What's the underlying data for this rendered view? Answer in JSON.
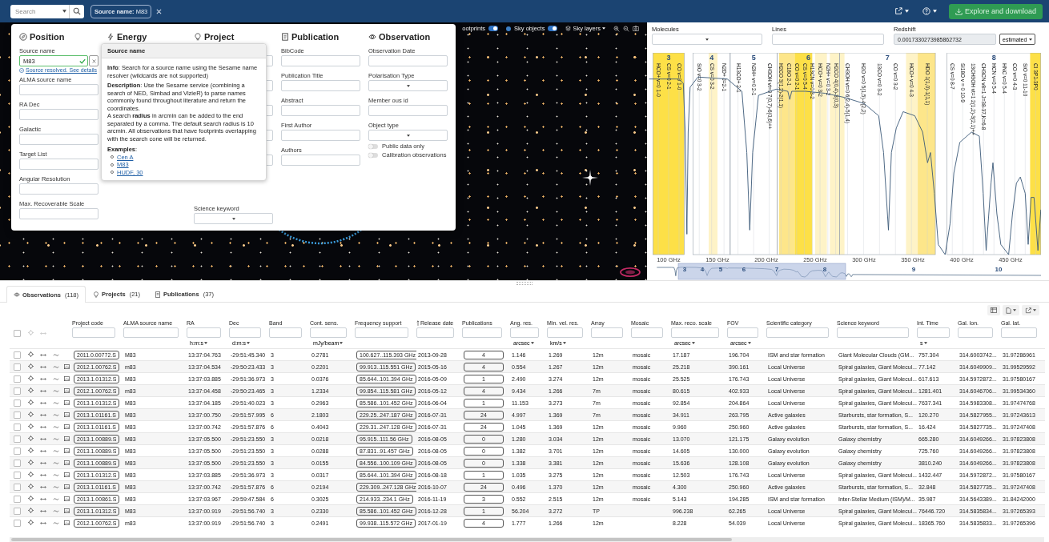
{
  "topbar": {
    "search_placeholder": "Search",
    "filter_chip": "**Source name:** M83",
    "explore_button": "Explore and download"
  },
  "sky": {
    "footprints_label": "ootprints",
    "footprints_on": true,
    "objects_label": "Sky objects",
    "objects_on": true,
    "layers_label": "Sky layers"
  },
  "search_panel": {
    "sections": [
      {
        "kind": "position",
        "title": "Position",
        "fields": [
          {
            "kind": "resolved",
            "label": "Source name",
            "value": "M83",
            "note": "Source resolved. See details"
          },
          {
            "kind": "text",
            "label": "ALMA source name"
          },
          {
            "kind": "text",
            "label": "RA Dec"
          },
          {
            "kind": "text",
            "label": "Galactic"
          },
          {
            "kind": "text",
            "label": "Target List"
          },
          {
            "kind": "text",
            "label": "Angular Resolution"
          },
          {
            "kind": "text",
            "label": "Max. Recoverable Scale"
          }
        ]
      },
      {
        "kind": "energy",
        "title": "Energy"
      },
      {
        "kind": "project",
        "title": "Project",
        "fields": [
          {
            "kind": "text"
          },
          {
            "kind": "text"
          },
          {
            "kind": "text"
          },
          {
            "kind": "text"
          },
          {
            "kind": "text"
          },
          {
            "kind": "select",
            "label": "Science keyword"
          }
        ]
      },
      {
        "kind": "publication",
        "title": "Publication",
        "fields": [
          {
            "kind": "text",
            "label": "BibCode"
          },
          {
            "kind": "text",
            "label": "Publication Title"
          },
          {
            "kind": "text",
            "label": "Abstract"
          },
          {
            "kind": "text",
            "label": "First Author"
          },
          {
            "kind": "text",
            "label": "Authors"
          }
        ]
      },
      {
        "kind": "observation",
        "title": "Observation",
        "fields": [
          {
            "kind": "text",
            "label": "Observation Date"
          },
          {
            "kind": "select",
            "label": "Polarisation Type"
          },
          {
            "kind": "text",
            "label": "Member ous id"
          },
          {
            "kind": "select",
            "label": "Object type"
          },
          {
            "kind": "toggle",
            "label": "Public data only",
            "on": false
          },
          {
            "kind": "toggle",
            "label": "Calibration observations",
            "on": false
          }
        ]
      }
    ],
    "tooltip": {
      "title": "Source name",
      "paragraphs": [
        "**Info**: Search for a source name using the Sesame name resolver (wildcards are not supported)",
        "**Description**: Use the Sesame service (combining a search of NED, Simbad and VizieR) to parse names commonly found throughout literature and return the coordinates.",
        "A search **radius** in arcmin can be added to the end separated by a comma. The default search radius is 10 arcmin. All observations that have footprints overlapping with the search cone will be returned."
      ],
      "examples_label": "**Examples**:",
      "examples": [
        "Cen A",
        "M83",
        "HUDF, 30"
      ]
    }
  },
  "spectrum": {
    "molecules_label": "Molecules",
    "lines_label": "Lines",
    "redshift_label": "Redshift",
    "redshift_value": "0.0017330273985862732",
    "redshift_mode": "estimated",
    "bands": [
      {
        "label": "3",
        "lines": [
          "HCO+ v=0 1-0",
          "CS v=0 2-1",
          "CO v=0 1-0"
        ]
      },
      {
        "label": "4",
        "lines": [
          "SiO v=0 3-2",
          "CS v=0 3-2",
          "N2D+ J=2-1"
        ]
      },
      {
        "label": "5",
        "lines": [
          "H13CO+ 2-1",
          "N2H+ v=0 2-1",
          "CH3OH vt=0 7(0,7)-6(0,6)++"
        ]
      },
      {
        "label": "6",
        "lines": [
          "H2CO 3(1,2)-2(1,1)",
          "C18O 2-1",
          "CO v=0 2-1",
          "CS v=0 5-4",
          "H13CN v=0 3-2",
          "HCO+ v=0 3-2",
          "N2H+ v=0 3-2",
          "H2CO 4(0,4)-3(0,3)"
        ]
      },
      {
        "label": "7",
        "lines": [
          "CH3OH vt=0 6(2,4)-5(1,4)",
          "H2O v=0 5(1,5)-4(2,2)",
          "13CO v=0 3-2",
          "CO v=0 3-2",
          "HCO+ v=0 4-3",
          "HDO 1(1,0)-1(1,1)"
        ]
      },
      {
        "label": "8",
        "lines": [
          "CS v=0 8-7",
          "Si18O v = 0 10-9",
          "13CH3OH vt=1 2(1,2)-3(2,1)++",
          "CH3CN v8=1 J=38-37,K=6-8",
          "HCN v=0 5-4",
          "HNC v=0 5-4",
          "CO v=0 4-3",
          "SiO v=0 11-10",
          "CI 3P1-3P0"
        ]
      }
    ],
    "xticks": [
      "100 GHz",
      "150 GHz",
      "200 GHz",
      "250 GHz",
      "300 GHz",
      "350 GHz",
      "400 GHz",
      "450 GHz"
    ],
    "overview_bands": [
      "3",
      "4",
      "5",
      "6",
      "7",
      "8",
      "9",
      "10"
    ]
  },
  "results": {
    "select_all": false,
    "tabs": [
      {
        "kind": "observations",
        "label": "Observations",
        "count": "(118)",
        "selected": true
      },
      {
        "kind": "projects",
        "label": "Projects",
        "count": "(21)",
        "selected": false
      },
      {
        "kind": "publications",
        "label": "Publications",
        "count": "(37)",
        "selected": false
      }
    ],
    "columns": [
      {
        "label": "Project code",
        "kind": "chip",
        "sorted": false
      },
      {
        "label": "ALMA source name",
        "kind": "text",
        "sorted": false
      },
      {
        "label": "RA",
        "kind": "text",
        "unit": "h:m:s",
        "sorted": false
      },
      {
        "label": "Dec",
        "kind": "text",
        "unit": "d:m:s",
        "sorted": false
      },
      {
        "label": "Band",
        "kind": "text",
        "sorted": false
      },
      {
        "label": "Cont. sens.",
        "kind": "text",
        "unit": "mJy/beam",
        "sorted": false
      },
      {
        "label": "Frequency support",
        "kind": "chip",
        "sorted": false
      },
      {
        "label": "Release date",
        "kind": "text",
        "sorted": true
      },
      {
        "label": "Publications",
        "kind": "chip",
        "sorted": false
      },
      {
        "label": "Ang. res.",
        "kind": "text",
        "unit": "arcsec",
        "sorted": false
      },
      {
        "label": "Min. vel. res.",
        "kind": "text",
        "unit": "km/s",
        "sorted": false
      },
      {
        "label": "Array",
        "kind": "text",
        "sorted": false
      },
      {
        "label": "Mosaic",
        "kind": "text",
        "sorted": false
      },
      {
        "label": "Max. reco. scale",
        "kind": "text",
        "unit": "arcsec",
        "sorted": false
      },
      {
        "label": "FOV",
        "kind": "text",
        "unit": "arcsec",
        "sorted": false
      },
      {
        "label": "Scientific category",
        "kind": "text",
        "sorted": false
      },
      {
        "label": "Science keyword",
        "kind": "text",
        "sorted": false
      },
      {
        "label": "Int. Time",
        "kind": "text",
        "unit": "s",
        "sorted": false
      },
      {
        "label": "Gal. lon.",
        "kind": "text",
        "sorted": false
      },
      {
        "label": "Gal. lat.",
        "kind": "text",
        "sorted": false
      }
    ],
    "rows": [
      {
        "selected": false,
        "preview": false,
        "cells": [
          "2011.0.00772.S",
          "M83",
          "13:37:04.763",
          "-29:51:45.340",
          "3",
          "0.2781",
          "100.627..115.393 GHz",
          "2013-09-28",
          "4",
          "1.146",
          "1.269",
          "12m",
          "mosaic",
          "17.187",
          "196.704",
          "ISM and star formation",
          "Giant Molecular Clouds (GM...",
          "757.304",
          "314.6003742...",
          "31.97286961"
        ]
      },
      {
        "selected": false,
        "preview": true,
        "cells": [
          "2012.1.00762.S",
          "m83",
          "13:37:04.534",
          "-29:50:23.433",
          "3",
          "0.2201",
          "99.913..115.551 GHz",
          "2015-05-16",
          "4",
          "0.554",
          "1.267",
          "12m",
          "mosaic",
          "25.218",
          "390.161",
          "Local Universe",
          "Spiral galaxies, Giant Molecul...",
          "77.142",
          "314.6049909...",
          "31.99529592"
        ]
      },
      {
        "selected": false,
        "preview": true,
        "cells": [
          "2013.1.01312.S",
          "M83",
          "13:37:03.885",
          "-29:51:36.973",
          "3",
          "0.0376",
          "85.644..101.394 GHz",
          "2016-05-09",
          "1",
          "2.490",
          "3.274",
          "12m",
          "mosaic",
          "25.525",
          "176.743",
          "Local Universe",
          "Spiral galaxies, Giant Molecul...",
          "617.613",
          "314.5972872...",
          "31.97580167"
        ]
      },
      {
        "selected": false,
        "preview": true,
        "cells": [
          "2012.1.00762.S",
          "m83",
          "13:37:04.458",
          "-29:50:23.465",
          "3",
          "1.2334",
          "99.854..115.581 GHz",
          "2016-05-12",
          "4",
          "9.434",
          "1.266",
          "7m",
          "mosaic",
          "80.615",
          "402.933",
          "Local Universe",
          "Spiral galaxies, Giant Molecul...",
          "1281.401",
          "314.6046706...",
          "31.99534360"
        ]
      },
      {
        "selected": false,
        "preview": true,
        "cells": [
          "2013.1.01312.S",
          "M83",
          "13:37:04.185",
          "-29:51:40.023",
          "3",
          "0.2963",
          "85.586..101.452 GHz",
          "2016-06-04",
          "1",
          "11.153",
          "3.273",
          "7m",
          "mosaic",
          "92.854",
          "204.864",
          "Local Universe",
          "Spiral galaxies, Giant Molecul...",
          "7637.341",
          "314.5983308...",
          "31.97474768"
        ]
      },
      {
        "selected": false,
        "preview": true,
        "cells": [
          "2013.1.01161.S",
          "M83",
          "13:37:00.750",
          "-29:51:57.995",
          "6",
          "2.1803",
          "229.25..247.187 GHz",
          "2016-07-31",
          "24",
          "4.997",
          "1.369",
          "7m",
          "mosaic",
          "34.911",
          "263.795",
          "Active galaxies",
          "Starbursts, star formation, S...",
          "120.270",
          "314.5827955...",
          "31.97243613"
        ]
      },
      {
        "selected": false,
        "preview": true,
        "cells": [
          "2013.1.01161.S",
          "M83",
          "13:37:00.742",
          "-29:51:57.876",
          "6",
          "0.4043",
          "229.31..247.128 GHz",
          "2016-07-31",
          "24",
          "1.045",
          "1.369",
          "12m",
          "mosaic",
          "9.960",
          "250.960",
          "Active galaxies",
          "Starbursts, star formation, S...",
          "16.424",
          "314.5827735...",
          "31.97247408"
        ]
      },
      {
        "selected": false,
        "preview": true,
        "cells": [
          "2013.1.00889.S",
          "M83",
          "13:37:05.500",
          "-29:51:23.550",
          "3",
          "0.0218",
          "95.915..111.56 GHz",
          "2016-08-05",
          "0",
          "1.280",
          "3.034",
          "12m",
          "mosaic",
          "13.070",
          "121.175",
          "Galaxy evolution",
          "Galaxy chemistry",
          "665.280",
          "314.6049266...",
          "31.97823808"
        ]
      },
      {
        "selected": false,
        "preview": true,
        "cells": [
          "2013.1.00889.S",
          "M83",
          "13:37:05.500",
          "-29:51:23.550",
          "3",
          "0.0288",
          "87.831..91.457 GHz",
          "2016-08-05",
          "0",
          "1.382",
          "3.701",
          "12m",
          "mosaic",
          "14.605",
          "130.000",
          "Galaxy evolution",
          "Galaxy chemistry",
          "725.760",
          "314.6049266...",
          "31.97823808"
        ]
      },
      {
        "selected": false,
        "preview": true,
        "cells": [
          "2013.1.00889.S",
          "M83",
          "13:37:05.500",
          "-29:51:23.550",
          "3",
          "0.0155",
          "84.556..100.109 GHz",
          "2016-08-05",
          "0",
          "1.338",
          "3.381",
          "12m",
          "mosaic",
          "15.636",
          "128.108",
          "Galaxy evolution",
          "Galaxy chemistry",
          "3810.240",
          "314.6049266...",
          "31.97823808"
        ]
      },
      {
        "selected": false,
        "preview": true,
        "cells": [
          "2013.1.01312.S",
          "M83",
          "13:37:03.885",
          "-29:51:36.973",
          "3",
          "0.0317",
          "85.644..101.394 GHz",
          "2016-08-18",
          "1",
          "1.035",
          "3.275",
          "12m",
          "mosaic",
          "12.503",
          "176.743",
          "Local Universe",
          "Spiral galaxies, Giant Molecul...",
          "1432.447",
          "314.5972872...",
          "31.97580167"
        ]
      },
      {
        "selected": false,
        "preview": true,
        "cells": [
          "2013.1.01161.S",
          "M83",
          "13:37:00.742",
          "-29:51:57.876",
          "6",
          "0.2194",
          "229.309..247.128 GHz",
          "2016-10-07",
          "24",
          "0.496",
          "1.370",
          "12m",
          "mosaic",
          "4.300",
          "250.960",
          "Active galaxies",
          "Starbursts, star formation, S...",
          "32.848",
          "314.5827735...",
          "31.97247408"
        ]
      },
      {
        "selected": false,
        "preview": true,
        "cells": [
          "2013.1.00861.S",
          "M83",
          "13:37:03.967",
          "-29:59:47.584",
          "6",
          "0.3025",
          "214.933..234.1 GHz",
          "2016-11-19",
          "3",
          "0.552",
          "2.515",
          "12m",
          "mosaic",
          "5.143",
          "194.285",
          "ISM and star formation",
          "Inter-Stellar Medium (ISM)/M...",
          "35.987",
          "314.5643389...",
          "31.84242000"
        ]
      },
      {
        "selected": false,
        "preview": true,
        "cells": [
          "2013.1.01312.S",
          "M83",
          "13:37:00.919",
          "-29:51:56.740",
          "3",
          "0.2330",
          "85.586..101.452 GHz",
          "2016-12-28",
          "1",
          "56.204",
          "3.272",
          "TP",
          null,
          "996.238",
          "62.265",
          "Local Universe",
          "Spiral galaxies, Giant Molecul...",
          "76446.720",
          "314.5835834...",
          "31.97265393"
        ]
      },
      {
        "selected": false,
        "preview": true,
        "cells": [
          "2012.1.00762.S",
          "m83",
          "13:37:00.919",
          "-29:51:56.740",
          "3",
          "0.2491",
          "99.938..115.572 GHz",
          "2017-01-19",
          "4",
          "1.777",
          "1.266",
          "12m",
          null,
          "8.228",
          "54.039",
          "Local Universe",
          "Spiral galaxies, Giant Molecul...",
          "18365.760",
          "314.5835833...",
          "31.97265396"
        ]
      }
    ]
  }
}
